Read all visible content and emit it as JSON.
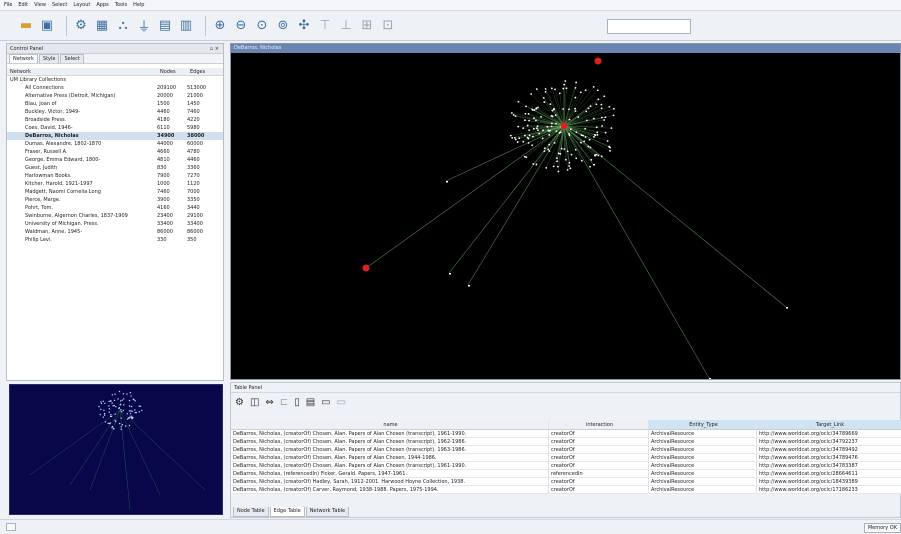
{
  "menu": [
    "File",
    "Edit",
    "View",
    "Select",
    "Layout",
    "Apps",
    "Tools",
    "Help"
  ],
  "toolbar": {
    "icons": [
      "open-folder-icon",
      "save-icon",
      "import-network-icon",
      "import-table-icon",
      "network-icon",
      "filter-icon",
      "layout-icon",
      "export-icon",
      "zoom-in-icon",
      "zoom-out-icon",
      "zoom-fit-icon",
      "zoom-selected-icon",
      "refresh-icon",
      "hide-icon",
      "show-icon",
      "expand-icon",
      "help-icon"
    ],
    "search_value": ""
  },
  "control_panel": {
    "title": "Control Panel",
    "tabs": [
      "Network",
      "Style",
      "Select"
    ],
    "columns": [
      "Network",
      "Nodes",
      "Edges"
    ],
    "rows": [
      {
        "name": "UM Library Collections",
        "nodes": "",
        "edges": "",
        "indent": 0
      },
      {
        "name": "All Connections",
        "nodes": "209100",
        "edges": "513000",
        "indent": 1
      },
      {
        "name": "Alternative Press (Detroit, Michigan)",
        "nodes": "20000",
        "edges": "21000",
        "indent": 1
      },
      {
        "name": "Blau, Joan of",
        "nodes": "1500",
        "edges": "1450",
        "indent": 1
      },
      {
        "name": "Buckley, Victor, 1949-",
        "nodes": "4460",
        "edges": "7460",
        "indent": 1
      },
      {
        "name": "Broadside Press.",
        "nodes": "4180",
        "edges": "4220",
        "indent": 1
      },
      {
        "name": "Coes, David, 1946-",
        "nodes": "6110",
        "edges": "5980",
        "indent": 1
      },
      {
        "name": "DeBarros, Nicholas",
        "nodes": "34900",
        "edges": "38000",
        "indent": 1,
        "selected": true
      },
      {
        "name": "Dumas, Alexandre, 1802-1870",
        "nodes": "44000",
        "edges": "60000",
        "indent": 1
      },
      {
        "name": "Fraser, Russell A.",
        "nodes": "4660",
        "edges": "4780",
        "indent": 1
      },
      {
        "name": "George, Emma Edward, 1800-",
        "nodes": "4810",
        "edges": "4460",
        "indent": 1
      },
      {
        "name": "Guest, Judith",
        "nodes": "830",
        "edges": "3360",
        "indent": 1
      },
      {
        "name": "Harlowman Books.",
        "nodes": "7900",
        "edges": "7270",
        "indent": 1
      },
      {
        "name": "Kitcher, Harold, 1921-1997",
        "nodes": "1000",
        "edges": "1120",
        "indent": 1
      },
      {
        "name": "Madgett, Naomi Cornelia Long",
        "nodes": "7460",
        "edges": "7000",
        "indent": 1
      },
      {
        "name": "Pierce, Marge.",
        "nodes": "3900",
        "edges": "3350",
        "indent": 1
      },
      {
        "name": "Pohrt, Tom.",
        "nodes": "4160",
        "edges": "3440",
        "indent": 1
      },
      {
        "name": "Swinburne, Algernon Charles, 1837-1909",
        "nodes": "23400",
        "edges": "29100",
        "indent": 1
      },
      {
        "name": "University of Michigan. Press.",
        "nodes": "33400",
        "edges": "33400",
        "indent": 1
      },
      {
        "name": "Waldman, Anne, 1945-",
        "nodes": "86000",
        "edges": "86000",
        "indent": 1
      },
      {
        "name": "Philip Levi.",
        "nodes": "330",
        "edges": "350",
        "indent": 1
      }
    ]
  },
  "network_view": {
    "title": "DeBarros, Nicholas"
  },
  "table_panel": {
    "title": "Table Panel",
    "tool_icons": [
      "gear-icon",
      "columns-icon",
      "link-icon",
      "function-icon",
      "new-table-icon",
      "delete-icon",
      "import-icon",
      "export-icon"
    ],
    "columns": [
      "name",
      "interaction",
      "Entity_Type",
      "Target_Link"
    ],
    "rows": [
      [
        "DeBarros, Nicholas, (creatorOf) Chosen, Alan. Papers of Alan Chosen (transcript), 1961-1990.",
        "creatorOf",
        "ArchivalResource",
        "http://www.worldcat.org/oclc/34789669"
      ],
      [
        "DeBarros, Nicholas, (creatorOf) Chosen, Alan. Papers of Alan Chosen (transcript), 1962-1986.",
        "creatorOf",
        "ArchivalResource",
        "http://www.worldcat.org/oclc/34792237"
      ],
      [
        "DeBarros, Nicholas, (creatorOf) Chosen, Alan. Papers of Alan Chosen (transcript), 1963-1986.",
        "creatorOf",
        "ArchivalResource",
        "http://www.worldcat.org/oclc/34789492"
      ],
      [
        "DeBarros, Nicholas, (creatorOf) Chosen, Alan. Papers of Alan Chosen, 1944-1986.",
        "creatorOf",
        "ArchivalResource",
        "http://www.worldcat.org/oclc/34789476"
      ],
      [
        "DeBarros, Nicholas, (creatorOf) Chosen, Alan. Papers of Alan Chosen (transcript), 1961-1990.",
        "creatorOf",
        "ArchivalResource",
        "http://www.worldcat.org/oclc/34783387"
      ],
      [
        "DeBarros, Nicholas, (referencedIn) Ficker, Gerald. Papers, 1947-1961.",
        "referencedIn",
        "ArchivalResource",
        "http://www.worldcat.org/oclc/28664611"
      ],
      [
        "DeBarros, Nicholas, (creatorOf) Hadley, Sarah, 1912-2001. Harwood Hoyne Collection, 1938.",
        "creatorOf",
        "ArchivalResource",
        "http://www.worldcat.org/oclc/18439389"
      ],
      [
        "DeBarros, Nicholas, (creatorOf) Carver, Raymond, 1938-1988. Papers, 1975-1994.",
        "creatorOf",
        "ArchivalResource",
        "http://www.worldcat.org/oclc/17186233"
      ]
    ],
    "tabs": [
      "Node Table",
      "Edge Table",
      "Network Table"
    ]
  },
  "status": {
    "memory_label": "Memory OK"
  },
  "colors": {
    "view_bg": "#000000",
    "navigator_bg": "#07074a",
    "edge": "#5ea05e",
    "node": "#ffffff",
    "hub_node": "#e02020",
    "selected_row": "#d2dff0"
  }
}
